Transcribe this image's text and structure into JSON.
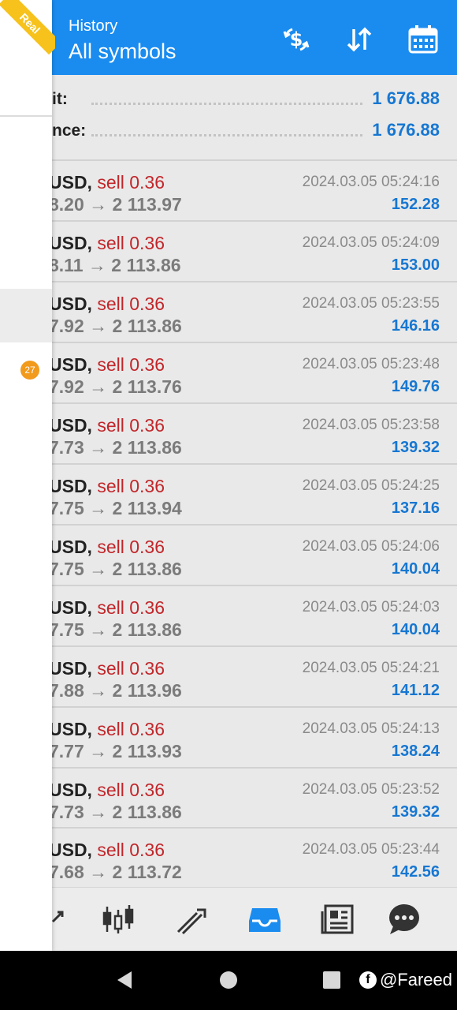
{
  "header": {
    "subtitle": "History",
    "title": "All symbols",
    "icons": [
      "currency-swap-icon",
      "sort-icon",
      "calendar-icon"
    ],
    "color": "#1a8cf0"
  },
  "summary": [
    {
      "label": "it:",
      "value": "1 676.88"
    },
    {
      "label": "nce:",
      "value": "1 676.88"
    }
  ],
  "deals": [
    {
      "symbol": "USD,",
      "side": "sell 0.36",
      "prices": "8.20 → 2 113.97",
      "time": "2024.03.05 05:24:16",
      "profit": "152.28"
    },
    {
      "symbol": "USD,",
      "side": "sell 0.36",
      "prices": "8.11 → 2 113.86",
      "time": "2024.03.05 05:24:09",
      "profit": "153.00"
    },
    {
      "symbol": "USD,",
      "side": "sell 0.36",
      "prices": "7.92 → 2 113.86",
      "time": "2024.03.05 05:23:55",
      "profit": "146.16"
    },
    {
      "symbol": "USD,",
      "side": "sell 0.36",
      "prices": "7.92 → 2 113.76",
      "time": "2024.03.05 05:23:48",
      "profit": "149.76"
    },
    {
      "symbol": "USD,",
      "side": "sell 0.36",
      "prices": "7.73 → 2 113.86",
      "time": "2024.03.05 05:23:58",
      "profit": "139.32"
    },
    {
      "symbol": "USD,",
      "side": "sell 0.36",
      "prices": "7.75 → 2 113.94",
      "time": "2024.03.05 05:24:25",
      "profit": "137.16"
    },
    {
      "symbol": "USD,",
      "side": "sell 0.36",
      "prices": "7.75 → 2 113.86",
      "time": "2024.03.05 05:24:06",
      "profit": "140.04"
    },
    {
      "symbol": "USD,",
      "side": "sell 0.36",
      "prices": "7.75 → 2 113.86",
      "time": "2024.03.05 05:24:03",
      "profit": "140.04"
    },
    {
      "symbol": "USD,",
      "side": "sell 0.36",
      "prices": "7.88 → 2 113.96",
      "time": "2024.03.05 05:24:21",
      "profit": "141.12"
    },
    {
      "symbol": "USD,",
      "side": "sell 0.36",
      "prices": "7.77 → 2 113.93",
      "time": "2024.03.05 05:24:13",
      "profit": "138.24"
    },
    {
      "symbol": "USD,",
      "side": "sell 0.36",
      "prices": "7.73 → 2 113.86",
      "time": "2024.03.05 05:23:52",
      "profit": "139.32"
    },
    {
      "symbol": "USD,",
      "side": "sell 0.36",
      "prices": "7.68 → 2 113.72",
      "time": "2024.03.05 05:23:44",
      "profit": "142.56"
    }
  ],
  "tabbar": {
    "items": [
      "quotes-icon",
      "chart-candles-icon",
      "trade-icon",
      "history-inbox-icon",
      "news-icon",
      "chat-icon"
    ],
    "active": "history-inbox-icon",
    "active_color": "#1a8cf0"
  },
  "drawer": {
    "account_ribbon": "Real",
    "badge": "27"
  },
  "navbar": {
    "watermark": "@Fareed"
  },
  "colors": {
    "sell": "#c2262a",
    "profit": "#1677d2",
    "badge": "#f19a1c",
    "ribbon": "#f6c21b"
  }
}
